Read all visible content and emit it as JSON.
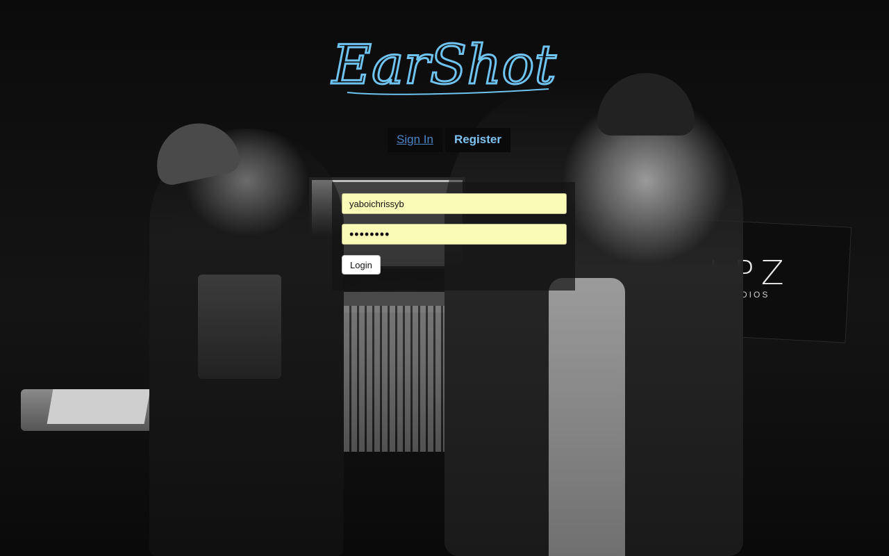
{
  "app": {
    "logo_text": "EarShot",
    "logo_color": "#6fc3f0"
  },
  "tabs": [
    {
      "label": "Sign In",
      "color": "#4a86c5"
    },
    {
      "label": "Register",
      "color": "#7ec3f2"
    }
  ],
  "form": {
    "username_value": "yaboichrissyb",
    "password_value": "12345678",
    "field_background": "#fafbb7",
    "login_label": "Login"
  },
  "background": {
    "banner_text": "LPZ",
    "banner_subtext": "TUDIOS"
  }
}
